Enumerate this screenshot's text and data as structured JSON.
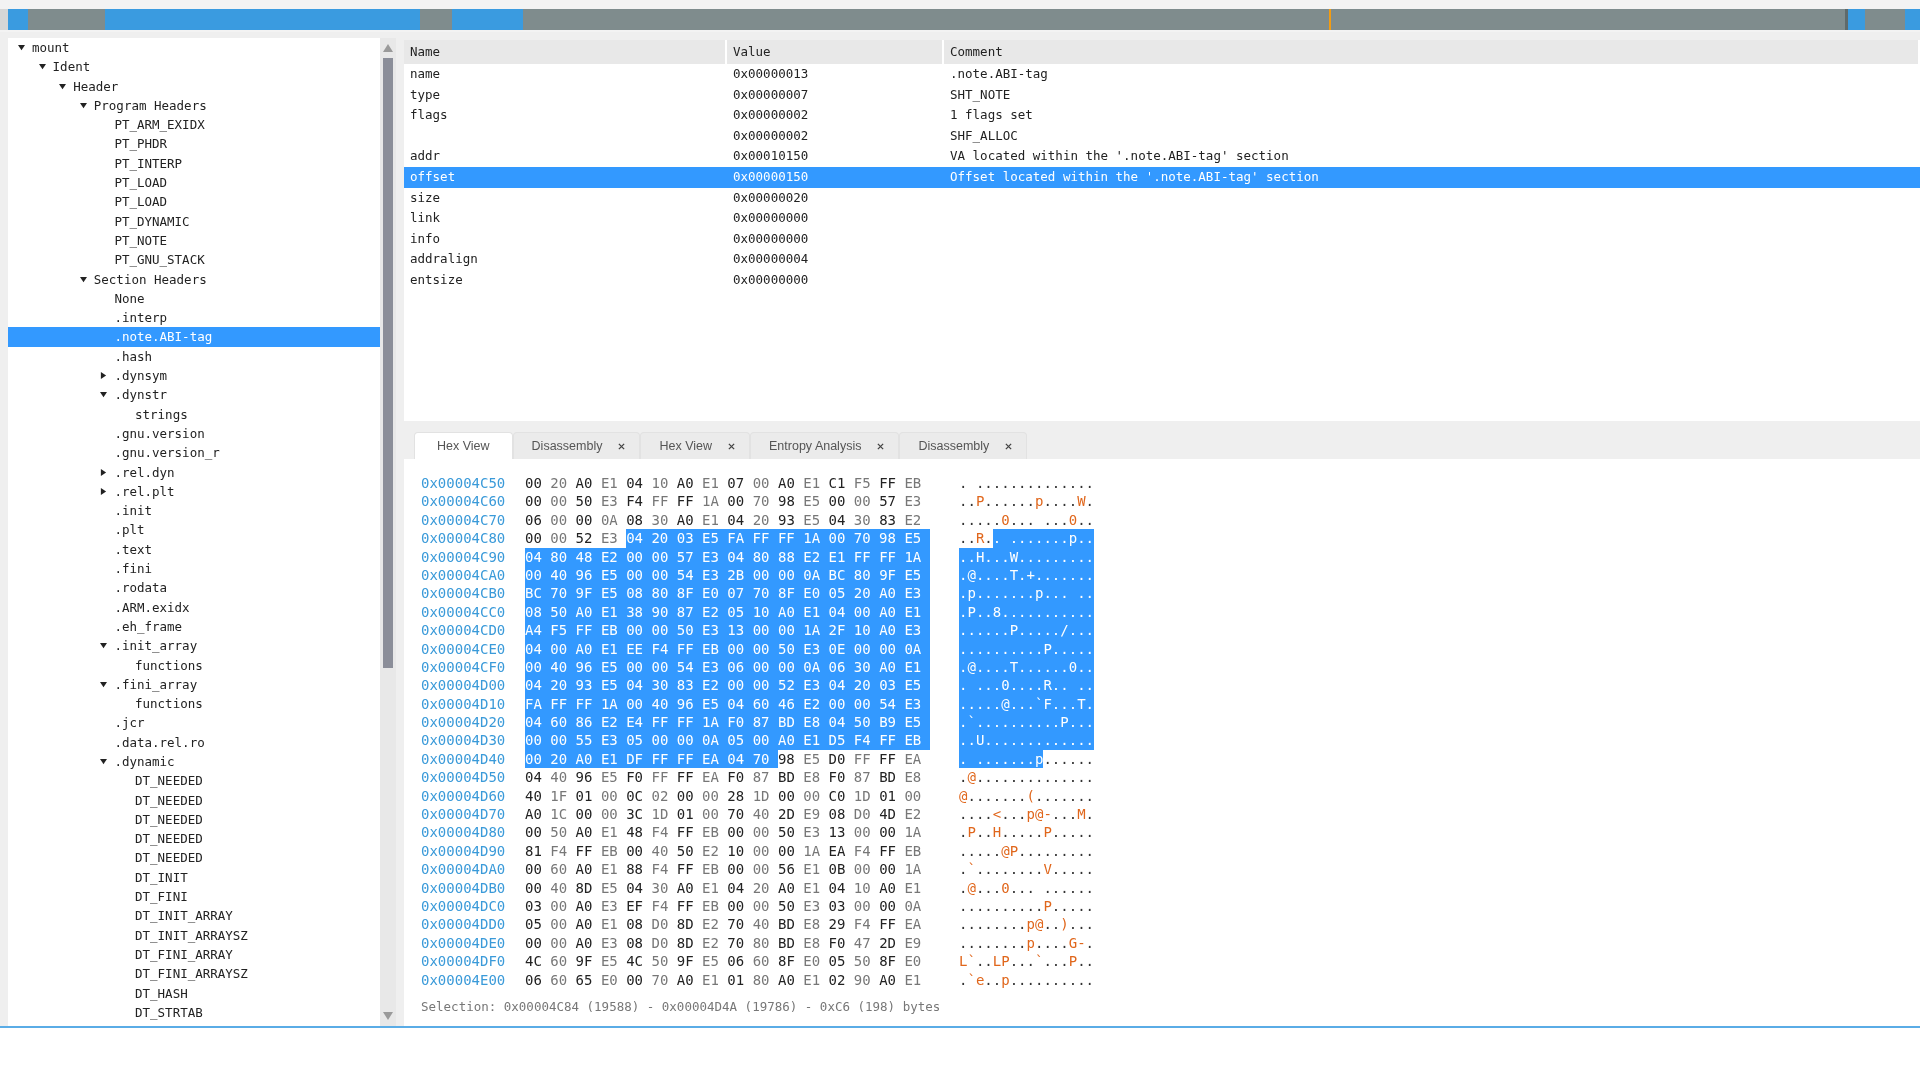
{
  "tree": [
    {
      "label": "mount",
      "expanded": true,
      "selected": false,
      "children": [
        {
          "label": "Ident",
          "expanded": true,
          "selected": false,
          "children": [
            {
              "label": "Header",
              "expanded": true,
              "selected": false,
              "children": [
                {
                  "label": "Program Headers",
                  "expanded": true,
                  "selected": false,
                  "children": [
                    {
                      "label": "PT_ARM_EXIDX",
                      "selected": false
                    },
                    {
                      "label": "PT_PHDR",
                      "selected": false
                    },
                    {
                      "label": "PT_INTERP",
                      "selected": false
                    },
                    {
                      "label": "PT_LOAD",
                      "selected": false
                    },
                    {
                      "label": "PT_LOAD",
                      "selected": false
                    },
                    {
                      "label": "PT_DYNAMIC",
                      "selected": false
                    },
                    {
                      "label": "PT_NOTE",
                      "selected": false
                    },
                    {
                      "label": "PT_GNU_STACK",
                      "selected": false
                    }
                  ]
                },
                {
                  "label": "Section Headers",
                  "expanded": true,
                  "selected": false,
                  "children": [
                    {
                      "label": "None",
                      "selected": false
                    },
                    {
                      "label": ".interp",
                      "selected": false
                    },
                    {
                      "label": ".note.ABI-tag",
                      "selected": true
                    },
                    {
                      "label": ".hash",
                      "selected": false
                    },
                    {
                      "label": ".dynsym",
                      "expanded": false,
                      "selected": false
                    },
                    {
                      "label": ".dynstr",
                      "expanded": true,
                      "selected": false,
                      "children": [
                        {
                          "label": "strings",
                          "selected": false
                        }
                      ]
                    },
                    {
                      "label": ".gnu.version",
                      "selected": false
                    },
                    {
                      "label": ".gnu.version_r",
                      "selected": false
                    },
                    {
                      "label": ".rel.dyn",
                      "expanded": false,
                      "selected": false
                    },
                    {
                      "label": ".rel.plt",
                      "expanded": false,
                      "selected": false
                    },
                    {
                      "label": ".init",
                      "selected": false
                    },
                    {
                      "label": ".plt",
                      "selected": false
                    },
                    {
                      "label": ".text",
                      "selected": false
                    },
                    {
                      "label": ".fini",
                      "selected": false
                    },
                    {
                      "label": ".rodata",
                      "selected": false
                    },
                    {
                      "label": ".ARM.exidx",
                      "selected": false
                    },
                    {
                      "label": ".eh_frame",
                      "selected": false
                    },
                    {
                      "label": ".init_array",
                      "expanded": true,
                      "selected": false,
                      "children": [
                        {
                          "label": "functions",
                          "selected": false
                        }
                      ]
                    },
                    {
                      "label": ".fini_array",
                      "expanded": true,
                      "selected": false,
                      "children": [
                        {
                          "label": "functions",
                          "selected": false
                        }
                      ]
                    },
                    {
                      "label": ".jcr",
                      "selected": false
                    },
                    {
                      "label": ".data.rel.ro",
                      "selected": false
                    },
                    {
                      "label": ".dynamic",
                      "expanded": true,
                      "selected": false,
                      "children": [
                        {
                          "label": "DT_NEEDED",
                          "selected": false
                        },
                        {
                          "label": "DT_NEEDED",
                          "selected": false
                        },
                        {
                          "label": "DT_NEEDED",
                          "selected": false
                        },
                        {
                          "label": "DT_NEEDED",
                          "selected": false
                        },
                        {
                          "label": "DT_NEEDED",
                          "selected": false
                        },
                        {
                          "label": "DT_INIT",
                          "selected": false
                        },
                        {
                          "label": "DT_FINI",
                          "selected": false
                        },
                        {
                          "label": "DT_INIT_ARRAY",
                          "selected": false
                        },
                        {
                          "label": "DT_INIT_ARRAYSZ",
                          "selected": false
                        },
                        {
                          "label": "DT_FINI_ARRAY",
                          "selected": false
                        },
                        {
                          "label": "DT_FINI_ARRAYSZ",
                          "selected": false
                        },
                        {
                          "label": "DT_HASH",
                          "selected": false
                        },
                        {
                          "label": "DT_STRTAB",
                          "selected": false
                        }
                      ]
                    }
                  ]
                }
              ]
            }
          ]
        }
      ]
    }
  ],
  "table": {
    "columns": [
      "Name",
      "Value",
      "Comment"
    ],
    "rows": [
      {
        "name": "name",
        "value": "0x00000013",
        "comment": ".note.ABI-tag",
        "selected": false
      },
      {
        "name": "type",
        "value": "0x00000007",
        "comment": "SHT_NOTE",
        "selected": false
      },
      {
        "name": "flags",
        "value": "0x00000002",
        "comment": "1 flags set",
        "selected": false
      },
      {
        "value": "0x00000002",
        "comment": "SHF_ALLOC",
        "selected": false
      },
      {
        "name": "addr",
        "value": "0x00010150",
        "comment": "VA located within the '.note.ABI-tag' section",
        "selected": false
      },
      {
        "name": "offset",
        "value": "0x00000150",
        "comment": "Offset located within the '.note.ABI-tag' section",
        "selected": true
      },
      {
        "name": "size",
        "value": "0x00000020",
        "selected": false
      },
      {
        "name": "link",
        "value": "0x00000000",
        "selected": false
      },
      {
        "name": "info",
        "value": "0x00000000",
        "selected": false
      },
      {
        "name": "addralign",
        "value": "0x00000004",
        "selected": false
      },
      {
        "name": "entsize",
        "value": "0x00000000",
        "selected": false
      }
    ]
  },
  "tabs": [
    {
      "label": "Hex View",
      "selected": true,
      "closable": false
    },
    {
      "label": "Disassembly",
      "selected": false,
      "closable": true
    },
    {
      "label": "Hex View",
      "selected": false,
      "closable": true
    },
    {
      "label": "Entropy Analysis",
      "selected": false,
      "closable": true
    },
    {
      "label": "Disassembly",
      "selected": false,
      "closable": true
    }
  ],
  "hex_rows": [
    {
      "address": "0x00004C50",
      "bytes": [
        {
          "text": "00 20 A0 E1 04 10 A0 E1 07 00 A0 E1 C1 F5 FF EB",
          "selected": false
        }
      ],
      "ascii": [
        {
          "text": ". ..............",
          "selected": false
        }
      ]
    },
    {
      "address": "0x00004C60",
      "bytes": [
        {
          "text": "00 00 50 E3 F4 FF FF 1A 00 70 98 E5 00 00 57 E3",
          "selected": false
        }
      ],
      "ascii": [
        {
          "text": "..P......p....W.",
          "selected": false
        }
      ]
    },
    {
      "address": "0x00004C70",
      "bytes": [
        {
          "text": "06 00 00 0A 08 30 A0 E1 04 20 93 E5 04 30 83 E2",
          "selected": false
        }
      ],
      "ascii": [
        {
          "text": ".....0... ...0..",
          "selected": false
        }
      ]
    },
    {
      "address": "0x00004C80",
      "bytes": [
        {
          "text": "00 00 52 E3",
          "selected": false
        },
        {
          "text": "04 20 03 E5 FA FF FF 1A 00 70 98 E5",
          "selected": true
        }
      ],
      "ascii": [
        {
          "text": "..R.",
          "selected": false
        },
        {
          "text": ". .......p..",
          "selected": true
        }
      ]
    },
    {
      "address": "0x00004C90",
      "bytes": [
        {
          "text": "04 80 48 E2 00 00 57 E3 04 80 88 E2 E1 FF FF 1A",
          "selected": true
        }
      ],
      "ascii": [
        {
          "text": "..H...W.........",
          "selected": true
        }
      ]
    },
    {
      "address": "0x00004CA0",
      "bytes": [
        {
          "text": "00 40 96 E5 00 00 54 E3 2B 00 00 0A BC 80 9F E5",
          "selected": true
        }
      ],
      "ascii": [
        {
          "text": ".@....T.+.......",
          "selected": true
        }
      ]
    },
    {
      "address": "0x00004CB0",
      "bytes": [
        {
          "text": "BC 70 9F E5 08 80 8F E0 07 70 8F E0 05 20 A0 E3",
          "selected": true
        }
      ],
      "ascii": [
        {
          "text": ".p.......p... ..",
          "selected": true
        }
      ]
    },
    {
      "address": "0x00004CC0",
      "bytes": [
        {
          "text": "08 50 A0 E1 38 90 87 E2 05 10 A0 E1 04 00 A0 E1",
          "selected": true
        }
      ],
      "ascii": [
        {
          "text": ".P..8...........",
          "selected": true
        }
      ]
    },
    {
      "address": "0x00004CD0",
      "bytes": [
        {
          "text": "A4 F5 FF EB 00 00 50 E3 13 00 00 1A 2F 10 A0 E3",
          "selected": true
        }
      ],
      "ascii": [
        {
          "text": "......P...../...",
          "selected": true
        }
      ]
    },
    {
      "address": "0x00004CE0",
      "bytes": [
        {
          "text": "04 00 A0 E1 EE F4 FF EB 00 00 50 E3 0E 00 00 0A",
          "selected": true
        }
      ],
      "ascii": [
        {
          "text": "..........P.....",
          "selected": true
        }
      ]
    },
    {
      "address": "0x00004CF0",
      "bytes": [
        {
          "text": "00 40 96 E5 00 00 54 E3 06 00 00 0A 06 30 A0 E1",
          "selected": true
        }
      ],
      "ascii": [
        {
          "text": ".@....T......0..",
          "selected": true
        }
      ]
    },
    {
      "address": "0x00004D00",
      "bytes": [
        {
          "text": "04 20 93 E5 04 30 83 E2 00 00 52 E3 04 20 03 E5",
          "selected": true
        }
      ],
      "ascii": [
        {
          "text": ". ...0....R.. ..",
          "selected": true
        }
      ]
    },
    {
      "address": "0x00004D10",
      "bytes": [
        {
          "text": "FA FF FF 1A 00 40 96 E5 04 60 46 E2 00 00 54 E3",
          "selected": true
        }
      ],
      "ascii": [
        {
          "text": ".....@...`F...T.",
          "selected": true
        }
      ]
    },
    {
      "address": "0x00004D20",
      "bytes": [
        {
          "text": "04 60 86 E2 E4 FF FF 1A F0 87 BD E8 04 50 B9 E5",
          "selected": true
        }
      ],
      "ascii": [
        {
          "text": ".`..........P...",
          "selected": true
        }
      ]
    },
    {
      "address": "0x00004D30",
      "bytes": [
        {
          "text": "00 00 55 E3 05 00 00 0A 05 00 A0 E1 D5 F4 FF EB",
          "selected": true
        }
      ],
      "ascii": [
        {
          "text": "..U.............",
          "selected": true
        }
      ]
    },
    {
      "address": "0x00004D40",
      "bytes": [
        {
          "text": "00 20 A0 E1 DF FF FF EA 04 70",
          "selected": true
        },
        {
          "text": "98 E5 D0 FF FF EA",
          "selected": false
        }
      ],
      "ascii": [
        {
          "text": ". .......p",
          "selected": true
        },
        {
          "text": "......",
          "selected": false
        }
      ]
    },
    {
      "address": "0x00004D50",
      "bytes": [
        {
          "text": "04 40 96 E5 F0 FF FF EA F0 87 BD E8 F0 87 BD E8",
          "selected": false
        }
      ],
      "ascii": [
        {
          "text": ".@..............",
          "selected": false
        }
      ]
    },
    {
      "address": "0x00004D60",
      "bytes": [
        {
          "text": "40 1F 01 00 0C 02 00 00 28 1D 00 00 C0 1D 01 00",
          "selected": false
        }
      ],
      "ascii": [
        {
          "text": "@.......(.......",
          "selected": false
        }
      ]
    },
    {
      "address": "0x00004D70",
      "bytes": [
        {
          "text": "A0 1C 00 00 3C 1D 01 00 70 40 2D E9 08 D0 4D E2",
          "selected": false
        }
      ],
      "ascii": [
        {
          "text": "....<...p@-...M.",
          "selected": false
        }
      ]
    },
    {
      "address": "0x00004D80",
      "bytes": [
        {
          "text": "00 50 A0 E1 48 F4 FF EB 00 00 50 E3 13 00 00 1A",
          "selected": false
        }
      ],
      "ascii": [
        {
          "text": ".P..H.....P.....",
          "selected": false
        }
      ]
    },
    {
      "address": "0x00004D90",
      "bytes": [
        {
          "text": "81 F4 FF EB 00 40 50 E2 10 00 00 1A EA F4 FF EB",
          "selected": false
        }
      ],
      "ascii": [
        {
          "text": ".....@P.........",
          "selected": false
        }
      ]
    },
    {
      "address": "0x00004DA0",
      "bytes": [
        {
          "text": "00 60 A0 E1 88 F4 FF EB 00 00 56 E1 0B 00 00 1A",
          "selected": false
        }
      ],
      "ascii": [
        {
          "text": ".`........V.....",
          "selected": false
        }
      ]
    },
    {
      "address": "0x00004DB0",
      "bytes": [
        {
          "text": "00 40 8D E5 04 30 A0 E1 04 20 A0 E1 04 10 A0 E1",
          "selected": false
        }
      ],
      "ascii": [
        {
          "text": ".@...0... ......",
          "selected": false
        }
      ]
    },
    {
      "address": "0x00004DC0",
      "bytes": [
        {
          "text": "03 00 A0 E3 EF F4 FF EB 00 00 50 E3 03 00 00 0A",
          "selected": false
        }
      ],
      "ascii": [
        {
          "text": "..........P.....",
          "selected": false
        }
      ]
    },
    {
      "address": "0x00004DD0",
      "bytes": [
        {
          "text": "05 00 A0 E1 08 D0 8D E2 70 40 BD E8 29 F4 FF EA",
          "selected": false
        }
      ],
      "ascii": [
        {
          "text": "........p@..)...",
          "selected": false
        }
      ]
    },
    {
      "address": "0x00004DE0",
      "bytes": [
        {
          "text": "00 00 A0 E3 08 D0 8D E2 70 80 BD E8 F0 47 2D E9",
          "selected": false
        }
      ],
      "ascii": [
        {
          "text": "........p....G-.",
          "selected": false
        }
      ]
    },
    {
      "address": "0x00004DF0",
      "bytes": [
        {
          "text": "4C 60 9F E5 4C 50 9F E5 06 60 8F E0 05 50 8F E0",
          "selected": false
        }
      ],
      "ascii": [
        {
          "text": "L`..LP...`...P..",
          "selected": false
        }
      ]
    },
    {
      "address": "0x00004E00",
      "bytes": [
        {
          "text": "06 60 65 E0 00 70 A0 E1 01 80 A0 E1 02 90 A0 E1",
          "selected": false
        }
      ],
      "ascii": [
        {
          "text": ".`e..p..........",
          "selected": false
        }
      ]
    }
  ],
  "status_bar": "Selection: 0x00004C84 (19588) - 0x00004D4A (19786) - 0xC6 (198) bytes"
}
